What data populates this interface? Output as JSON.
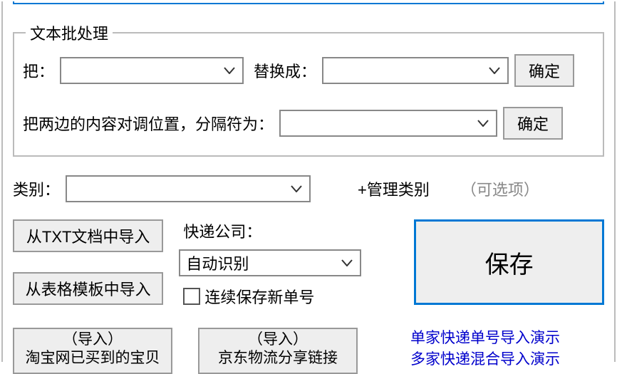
{
  "text_batch": {
    "legend": "文本批处理",
    "label_put": "把：",
    "combo_put_value": "",
    "label_replace": "替换成：",
    "combo_replace_value": "",
    "confirm1": "确定",
    "label_swap": "把两边的内容对调位置，分隔符为：",
    "combo_sep_value": "",
    "confirm2": "确定"
  },
  "category": {
    "label": "类别：",
    "combo_value": "",
    "manage": "+管理类别",
    "optional": "（可选项）"
  },
  "imports": {
    "from_txt": "从TXT文档中导入",
    "from_table": "从表格模板中导入"
  },
  "courier": {
    "label": "快递公司：",
    "value": "自动识别",
    "continuous": "连续保存新单号"
  },
  "save": "保存",
  "bottom": {
    "taobao_top": "（导入）",
    "taobao_bottom": "淘宝网已买到的宝贝",
    "jd_top": "（导入）",
    "jd_bottom": "京东物流分享链接"
  },
  "demo": {
    "single": "单家快递单号导入演示",
    "multi": "多家快递混合导入演示"
  }
}
